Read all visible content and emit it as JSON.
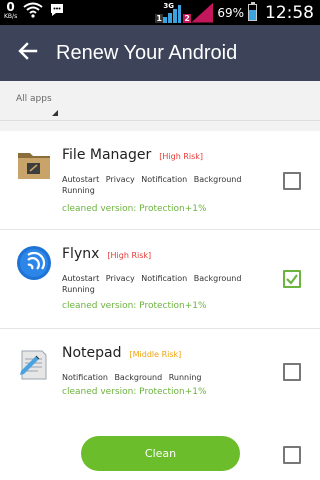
{
  "status_bar": {
    "speed_value": "0",
    "speed_unit": "KB/s",
    "network_type": "3G",
    "sim1": "1",
    "sim2": "2",
    "battery_percent": "69%",
    "battery_level": 0.69,
    "time": "12:58",
    "icons": [
      "wifi-icon",
      "chat-icon",
      "signal-icon",
      "battery-icon"
    ]
  },
  "header": {
    "title": "Renew Your Android",
    "back_icon": "back-arrow-icon",
    "background": "#3d4359"
  },
  "filter": {
    "label": "All apps"
  },
  "apps": [
    {
      "name": "File Manager",
      "risk": "[High Risk]",
      "risk_color": "#e53935",
      "permissions": "Autostart Privacy Notification Background Running",
      "cleaned": "cleaned version: Protection+1%",
      "checked": false,
      "icon": "folder-icon"
    },
    {
      "name": "Flynx",
      "risk": "[High Risk]",
      "risk_color": "#e53935",
      "permissions": "Autostart Privacy Notification Background Running",
      "cleaned": "cleaned version: Protection+1%",
      "checked": true,
      "icon": "flynx-icon"
    },
    {
      "name": "Notepad",
      "risk": "[Middle Risk]",
      "risk_color": "#f0a30a",
      "permissions": "Notification Background Running",
      "cleaned": "cleaned version: Protection+1%",
      "checked": false,
      "icon": "notepad-icon"
    }
  ],
  "actions": {
    "clean_label": "Clean",
    "accent": "#6bbd2b"
  }
}
